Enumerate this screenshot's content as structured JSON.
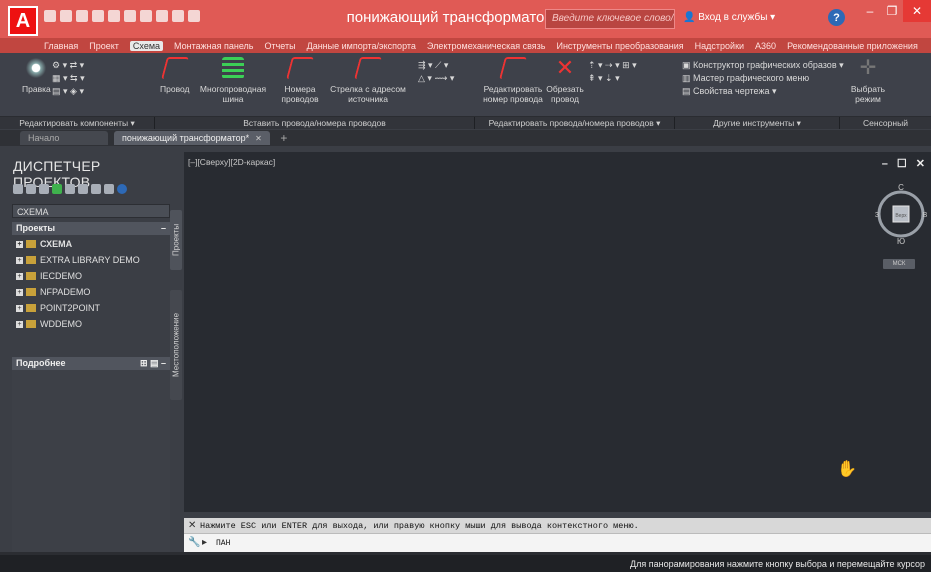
{
  "title": "понижающий трансформатор.dwg",
  "search_placeholder": "Введите ключевое слово/фразу",
  "signin": "Вход в службы",
  "help_label": "?",
  "app_logo_letter": "A",
  "window_controls": {
    "minimize": "–",
    "restore": "❐",
    "close": "✕"
  },
  "tabs": [
    "Главная",
    "Проект",
    "Схема",
    "Монтажная панель",
    "Отчеты",
    "Данные импорта/экспорта",
    "Электромеханическая связь",
    "Инструменты преобразования",
    "Надстройки",
    "A360",
    "Рекомендованные приложения"
  ],
  "active_tab": "Схема",
  "ribbon": {
    "edit_components": "Правка",
    "wire": "Провод",
    "multiwire": "Многопроводная шина",
    "wire_numbers": "Номера проводов",
    "source_arrow": "Стрелка с адресом источника",
    "edit_wire_number": "Редактировать номер провода",
    "trim_wire": "Обрезать провод",
    "icon_builder": "Конструктор графических образов",
    "icon_wizard": "Мастер графического меню",
    "drawing_properties": "Свойства чертежа",
    "select_mode": "Выбрать режим"
  },
  "panels": [
    {
      "label": "Редактировать компоненты"
    },
    {
      "label": "Вставить провода/номера проводов"
    },
    {
      "label": "Редактировать провода/номера проводов"
    },
    {
      "label": "Другие инструменты"
    },
    {
      "label": "Сенсорный"
    }
  ],
  "doc_tabs": {
    "start": "Начало",
    "active": "понижающий трансформатор*"
  },
  "project_manager": {
    "title": "ДИСПЕТЧЕР ПРОЕКТОВ",
    "dropdown": "СХЕМА",
    "projects_header": "Проекты",
    "projects": [
      "СХЕМА",
      "EXTRA LIBRARY DEMO",
      "IECDEMO",
      "NFPADEMO",
      "POINT2POINT",
      "WDDEMO"
    ],
    "details_header": "Подробнее"
  },
  "side_tabs": {
    "projects": "Проекты",
    "location": "Местоположение"
  },
  "viewport": {
    "label": "[–][Сверху][2D-каркас]",
    "controls": "– ☐ ✕",
    "viewcube_top": "С",
    "viewcube_bottom": "Ю",
    "viewcube_left": "З",
    "viewcube_right": "В",
    "viewcube_face": "Верх",
    "ucs_label": "МСК"
  },
  "command_line": {
    "history": "Нажмите ESC или ENTER для выхода, или правую кнопку мыши для вывода контекстного меню.",
    "prompt": "ПАН"
  },
  "status": "Для панорамирования нажмите кнопку выбора и перемещайте курсор"
}
